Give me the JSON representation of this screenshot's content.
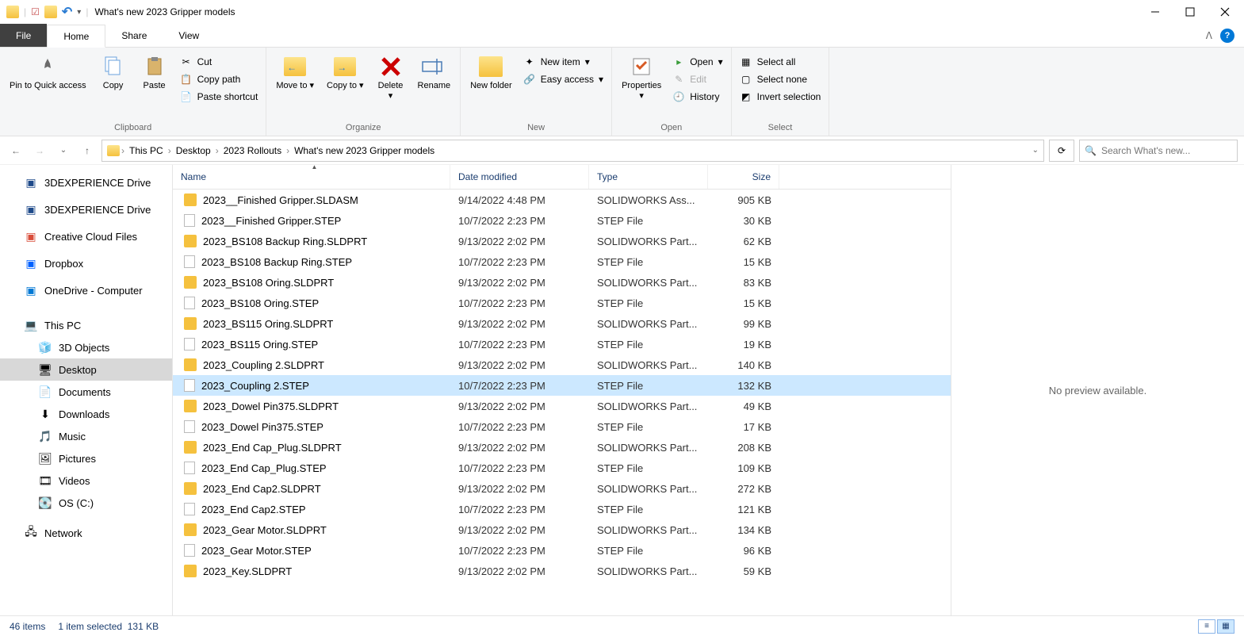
{
  "window": {
    "title": "What's new 2023 Gripper models"
  },
  "tabs": {
    "file": "File",
    "home": "Home",
    "share": "Share",
    "view": "View"
  },
  "ribbon": {
    "clipboard": {
      "label": "Clipboard",
      "pin": "Pin to Quick access",
      "copy": "Copy",
      "paste": "Paste",
      "cut": "Cut",
      "copypath": "Copy path",
      "pasteshortcut": "Paste shortcut"
    },
    "organize": {
      "label": "Organize",
      "moveto": "Move to",
      "copyto": "Copy to",
      "delete": "Delete",
      "rename": "Rename"
    },
    "new": {
      "label": "New",
      "newfolder": "New folder",
      "newitem": "New item",
      "easyaccess": "Easy access"
    },
    "open": {
      "label": "Open",
      "properties": "Properties",
      "open": "Open",
      "edit": "Edit",
      "history": "History"
    },
    "select": {
      "label": "Select",
      "selectall": "Select all",
      "selectnone": "Select none",
      "invert": "Invert selection"
    }
  },
  "breadcrumb": {
    "items": [
      "This PC",
      "Desktop",
      "2023 Rollouts",
      "What's new 2023 Gripper models"
    ]
  },
  "search": {
    "placeholder": "Search What's new..."
  },
  "nav": {
    "items": [
      {
        "label": "3DEXPERIENCE Drive",
        "icon": "drive",
        "color": "#1e4a8a"
      },
      {
        "label": "3DEXPERIENCE Drive",
        "icon": "drive",
        "color": "#1e4a8a"
      },
      {
        "label": "Creative Cloud Files",
        "icon": "cc",
        "color": "#d94d3a"
      },
      {
        "label": "Dropbox",
        "icon": "dropbox",
        "color": "#0061ff"
      },
      {
        "label": "OneDrive - Computer",
        "icon": "onedrive",
        "color": "#0078d4"
      }
    ],
    "thispc": "This PC",
    "thispc_items": [
      {
        "label": "3D Objects",
        "icon": "3d"
      },
      {
        "label": "Desktop",
        "icon": "desktop",
        "selected": true
      },
      {
        "label": "Documents",
        "icon": "documents"
      },
      {
        "label": "Downloads",
        "icon": "downloads"
      },
      {
        "label": "Music",
        "icon": "music"
      },
      {
        "label": "Pictures",
        "icon": "pictures"
      },
      {
        "label": "Videos",
        "icon": "videos"
      },
      {
        "label": "OS (C:)",
        "icon": "disk"
      }
    ],
    "network": "Network"
  },
  "columns": {
    "name": "Name",
    "date": "Date modified",
    "type": "Type",
    "size": "Size"
  },
  "files": [
    {
      "name": "2023__Finished Gripper.SLDASM",
      "date": "9/14/2022 4:48 PM",
      "type": "SOLIDWORKS Ass...",
      "size": "905 KB",
      "ico": "asm"
    },
    {
      "name": "2023__Finished Gripper.STEP",
      "date": "10/7/2022 2:23 PM",
      "type": "STEP File",
      "size": "30 KB",
      "ico": "step"
    },
    {
      "name": "2023_BS108 Backup Ring.SLDPRT",
      "date": "9/13/2022 2:02 PM",
      "type": "SOLIDWORKS Part...",
      "size": "62 KB",
      "ico": "prt"
    },
    {
      "name": "2023_BS108 Backup Ring.STEP",
      "date": "10/7/2022 2:23 PM",
      "type": "STEP File",
      "size": "15 KB",
      "ico": "step"
    },
    {
      "name": "2023_BS108 Oring.SLDPRT",
      "date": "9/13/2022 2:02 PM",
      "type": "SOLIDWORKS Part...",
      "size": "83 KB",
      "ico": "prt"
    },
    {
      "name": "2023_BS108 Oring.STEP",
      "date": "10/7/2022 2:23 PM",
      "type": "STEP File",
      "size": "15 KB",
      "ico": "step"
    },
    {
      "name": "2023_BS115 Oring.SLDPRT",
      "date": "9/13/2022 2:02 PM",
      "type": "SOLIDWORKS Part...",
      "size": "99 KB",
      "ico": "prt"
    },
    {
      "name": "2023_BS115 Oring.STEP",
      "date": "10/7/2022 2:23 PM",
      "type": "STEP File",
      "size": "19 KB",
      "ico": "step"
    },
    {
      "name": "2023_Coupling 2.SLDPRT",
      "date": "9/13/2022 2:02 PM",
      "type": "SOLIDWORKS Part...",
      "size": "140 KB",
      "ico": "prt"
    },
    {
      "name": "2023_Coupling 2.STEP",
      "date": "10/7/2022 2:23 PM",
      "type": "STEP File",
      "size": "132 KB",
      "ico": "step",
      "selected": true
    },
    {
      "name": "2023_Dowel Pin375.SLDPRT",
      "date": "9/13/2022 2:02 PM",
      "type": "SOLIDWORKS Part...",
      "size": "49 KB",
      "ico": "prt"
    },
    {
      "name": "2023_Dowel Pin375.STEP",
      "date": "10/7/2022 2:23 PM",
      "type": "STEP File",
      "size": "17 KB",
      "ico": "step"
    },
    {
      "name": "2023_End Cap_Plug.SLDPRT",
      "date": "9/13/2022 2:02 PM",
      "type": "SOLIDWORKS Part...",
      "size": "208 KB",
      "ico": "prt"
    },
    {
      "name": "2023_End Cap_Plug.STEP",
      "date": "10/7/2022 2:23 PM",
      "type": "STEP File",
      "size": "109 KB",
      "ico": "step"
    },
    {
      "name": "2023_End Cap2.SLDPRT",
      "date": "9/13/2022 2:02 PM",
      "type": "SOLIDWORKS Part...",
      "size": "272 KB",
      "ico": "prt"
    },
    {
      "name": "2023_End Cap2.STEP",
      "date": "10/7/2022 2:23 PM",
      "type": "STEP File",
      "size": "121 KB",
      "ico": "step"
    },
    {
      "name": "2023_Gear Motor.SLDPRT",
      "date": "9/13/2022 2:02 PM",
      "type": "SOLIDWORKS Part...",
      "size": "134 KB",
      "ico": "prt"
    },
    {
      "name": "2023_Gear Motor.STEP",
      "date": "10/7/2022 2:23 PM",
      "type": "STEP File",
      "size": "96 KB",
      "ico": "step"
    },
    {
      "name": "2023_Key.SLDPRT",
      "date": "9/13/2022 2:02 PM",
      "type": "SOLIDWORKS Part...",
      "size": "59 KB",
      "ico": "prt"
    }
  ],
  "preview": {
    "text": "No preview available."
  },
  "status": {
    "count": "46 items",
    "selection": "1 item selected",
    "size": "131 KB"
  }
}
